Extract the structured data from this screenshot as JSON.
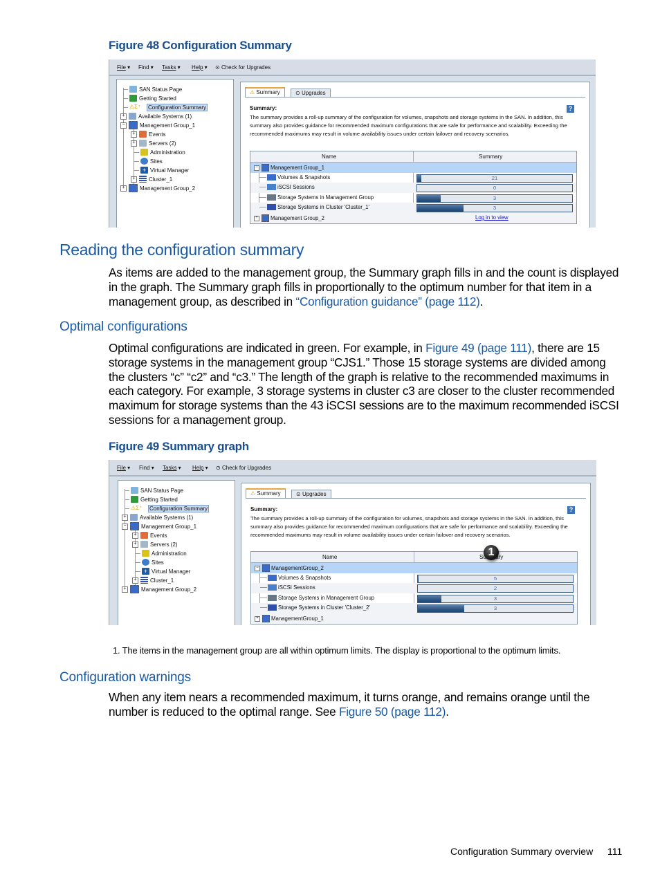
{
  "figure48": {
    "caption": "Figure 48 Configuration Summary",
    "menu": [
      "File",
      "Find",
      "Tasks",
      "Help"
    ],
    "check_upgrades": "Check for Upgrades",
    "tree": [
      {
        "label": "SAN Status Page",
        "icon": "home-icon"
      },
      {
        "label": "Getting Started",
        "icon": "arrow-right-icon"
      },
      {
        "label": "Configuration Summary",
        "icon": "warning-sigma-icon",
        "selected": true
      },
      {
        "label": "Available Systems (1)",
        "icon": "systems-icon"
      },
      {
        "label": "Management Group_1",
        "icon": "management-group-icon"
      },
      {
        "label": "Events",
        "icon": "events-icon"
      },
      {
        "label": "Servers (2)",
        "icon": "servers-icon"
      },
      {
        "label": "Administration",
        "icon": "key-icon"
      },
      {
        "label": "Sites",
        "icon": "globe-icon"
      },
      {
        "label": "Virtual Manager",
        "icon": "plus-icon"
      },
      {
        "label": "Cluster_1",
        "icon": "cluster-icon"
      },
      {
        "label": "Management Group_2",
        "icon": "management-group-icon"
      }
    ],
    "tabs": [
      "Summary",
      "Upgrades"
    ],
    "summary_heading": "Summary:",
    "help": "?",
    "description": "The summary provides a roll-up summary of the configuration for volumes, snapshots and storage systems in the SAN. In addition, this summary also provides guidance for recommended maximum configurations that are safe for performance and scalability. Exceeding the recommended maximums may result in volume availability issues under certain failover and recovery scenarios.",
    "table": {
      "headers": [
        "Name",
        "Summary"
      ],
      "group": "Management Group_1",
      "rows": [
        {
          "label": "Volumes & Snapshots",
          "value": "21",
          "fill_pct": 2.5
        },
        {
          "label": "iSCSI Sessions",
          "value": "0",
          "fill_pct": 0
        },
        {
          "label": "Storage Systems in Management Group",
          "value": "3",
          "fill_pct": 15
        },
        {
          "label": "Storage Systems in Cluster 'Cluster_1'",
          "value": "3",
          "fill_pct": 30
        }
      ],
      "collapsed_group": "Management Group_2",
      "collapsed_link": "Log in to view"
    }
  },
  "section1": {
    "title": "Reading the configuration summary",
    "body_pre": "As items are added to the management group, the Summary graph fills in and the count is displayed in the graph. The Summary graph fills in proportionally to the optimum number for that item in a management group, as described in ",
    "link": "“Configuration guidance” (page 112)",
    "body_post": "."
  },
  "section2": {
    "title": "Optimal configurations",
    "body_pre": "Optimal configurations are indicated in green. For example, in ",
    "link": "Figure 49 (page 111)",
    "body_post": ", there are 15 storage systems in the management group “CJS1.” Those 15 storage systems are divided among the clusters “c” “c2” and “c3.” The length of the graph is relative to the recommended maximums in each category. For example, 3 storage systems in cluster c3 are closer to the cluster recommended maximum for storage systems than the 43 iSCSI sessions are to the maximum recommended iSCSI sessions for a management group."
  },
  "figure49": {
    "caption": "Figure 49 Summary graph",
    "menu": [
      "File",
      "Find",
      "Tasks",
      "Help"
    ],
    "check_upgrades": "Check for Upgrades",
    "tree": [
      {
        "label": "SAN Status Page"
      },
      {
        "label": "Getting Started"
      },
      {
        "label": "Configuration Summary",
        "selected": true
      },
      {
        "label": "Available Systems (1)"
      },
      {
        "label": "Management Group_1"
      },
      {
        "label": "Events"
      },
      {
        "label": "Servers (2)"
      },
      {
        "label": "Administration"
      },
      {
        "label": "Sites"
      },
      {
        "label": "Virtual Manager"
      },
      {
        "label": "Cluster_1"
      },
      {
        "label": "Management Group_2"
      }
    ],
    "tabs": [
      "Summary",
      "Upgrades"
    ],
    "summary_heading": "Summary:",
    "help": "?",
    "description": "The summary provides a roll-up summary of the configuration for volumes, snapshots and storage systems in the SAN. In addition, this summary also provides guidance for recommended maximum configurations that are safe for performance and scalability. Exceeding the recommended maximums may result in volume availability issues under certain failover and recovery scenarios.",
    "callout": "1",
    "table": {
      "headers": [
        "Name",
        "Summary"
      ],
      "group": "ManagementGroup_2",
      "rows": [
        {
          "label": "Volumes & Snapshots",
          "value": "5",
          "fill_pct": 0.5
        },
        {
          "label": "iSCSI Sessions",
          "value": "2",
          "fill_pct": 0
        },
        {
          "label": "Storage Systems in Management Group",
          "value": "3",
          "fill_pct": 15
        },
        {
          "label": "Storage Systems in Cluster 'Cluster_2'",
          "value": "3",
          "fill_pct": 30
        }
      ],
      "collapsed_group": "ManagementGroup_1"
    },
    "footnote": "1. The items in the management group are all within optimum limits. The display is proportional to the optimum limits."
  },
  "section3": {
    "title": "Configuration warnings",
    "body_pre": "When any item nears a recommended maximum, it turns orange, and remains orange until the number is reduced to the optimal range. See ",
    "link": "Figure 50 (page 112)",
    "body_post": "."
  },
  "footer": {
    "section": "Configuration Summary overview",
    "page": "111"
  }
}
